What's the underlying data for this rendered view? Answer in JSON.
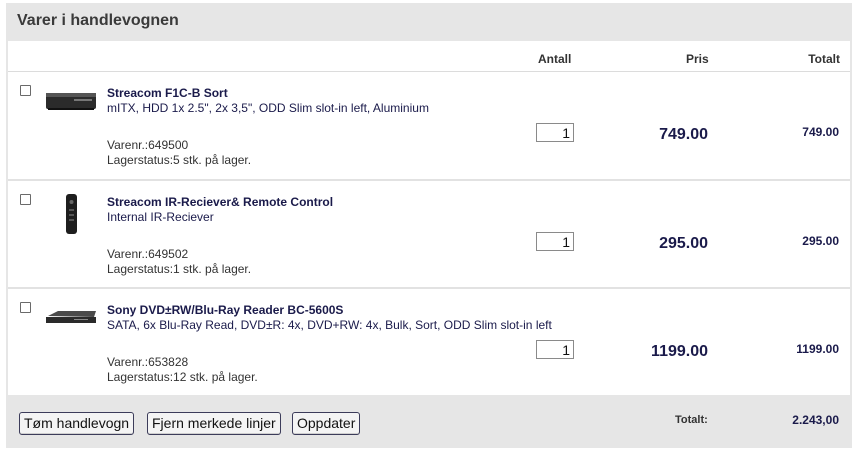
{
  "cart": {
    "title": "Varer i handlevognen",
    "columns": {
      "antall": "Antall",
      "pris": "Pris",
      "totalt": "Totalt"
    },
    "items": [
      {
        "name": "Streacom F1C-B Sort",
        "description": "mITX, HDD 1x 2.5\", 2x 3,5\", ODD Slim slot-in left, Aluminium",
        "varenr": "Varenr.:649500",
        "lager": "Lagerstatus:5 stk. på lager.",
        "quantity": "1",
        "price": "749.00",
        "total": "749.00",
        "checked": false,
        "thumb_icon": "case-thumbnail"
      },
      {
        "name": "Streacom IR-Reciever& Remote Control",
        "description": "Internal IR-Reciever",
        "varenr": "Varenr.:649502",
        "lager": "Lagerstatus:1 stk. på lager.",
        "quantity": "1",
        "price": "295.00",
        "total": "295.00",
        "checked": false,
        "thumb_icon": "remote-thumbnail"
      },
      {
        "name": "Sony DVD±RW/Blu-Ray Reader BC-5600S",
        "description": "SATA, 6x Blu-Ray Read, DVD±R: 4x, DVD+RW: 4x, Bulk, Sort, ODD Slim slot-in left",
        "varenr": "Varenr.:653828",
        "lager": "Lagerstatus:12 stk. på lager.",
        "quantity": "1",
        "price": "1199.00",
        "total": "1199.00",
        "checked": false,
        "thumb_icon": "drive-thumbnail"
      }
    ]
  },
  "footer": {
    "empty_button": "Tøm handlevogn",
    "remove_button": "Fjern merkede linjer",
    "update_button": "Oppdater",
    "total_label": "Totalt:",
    "total_value": "2.243,00"
  },
  "colors": {
    "panel_bg": "#e6e6e6",
    "text_navy": "#1a1a4a"
  }
}
